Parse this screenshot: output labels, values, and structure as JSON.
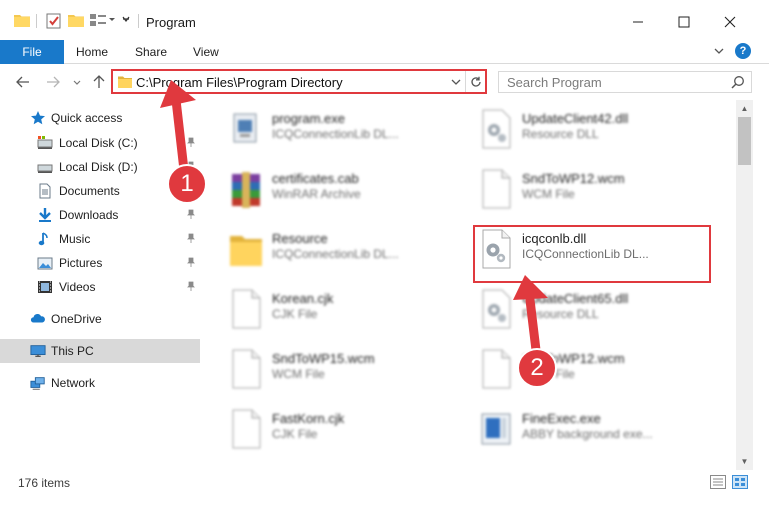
{
  "window": {
    "title": "Program",
    "minimize_icon": "minimize-icon",
    "maximize_icon": "maximize-icon",
    "close_icon": "close-icon"
  },
  "ribbon": {
    "tabs": [
      {
        "label": "File",
        "active": true
      },
      {
        "label": "Home"
      },
      {
        "label": "Share"
      },
      {
        "label": "View"
      }
    ],
    "help": "?"
  },
  "address": {
    "path": "C:\\Program Files\\Program Directory",
    "search_placeholder": "Search Program"
  },
  "sidebar": {
    "items": [
      {
        "label": "Quick access",
        "icon": "star-icon",
        "pinned": false
      },
      {
        "label": "Local Disk (C:)",
        "icon": "drive-icon",
        "pinned": true
      },
      {
        "label": "Local Disk (D:)",
        "icon": "drive-icon",
        "pinned": true
      },
      {
        "label": "Documents",
        "icon": "documents-icon",
        "pinned": true
      },
      {
        "label": "Downloads",
        "icon": "download-icon",
        "pinned": true
      },
      {
        "label": "Music",
        "icon": "music-icon",
        "pinned": true
      },
      {
        "label": "Pictures",
        "icon": "pictures-icon",
        "pinned": true
      },
      {
        "label": "Videos",
        "icon": "videos-icon",
        "pinned": true
      },
      {
        "label": "OneDrive",
        "icon": "cloud-icon",
        "pinned": false
      },
      {
        "label": "This PC",
        "icon": "computer-icon",
        "pinned": false,
        "selected": true
      },
      {
        "label": "Network",
        "icon": "network-icon",
        "pinned": false
      }
    ]
  },
  "files": [
    {
      "name": "program.exe",
      "type": "ICQConnectionLib DL...",
      "icon": "exe-icon"
    },
    {
      "name": "UpdateClient42.dll",
      "type": "Resource DLL",
      "icon": "dll-icon"
    },
    {
      "name": "certificates.cab",
      "type": "WinRAR Archive",
      "icon": "archive-icon"
    },
    {
      "name": "SndToWP12.wcm",
      "type": "WCM File",
      "icon": "document-icon"
    },
    {
      "name": "Resource",
      "type": "ICQConnectionLib DL...",
      "icon": "folder-icon"
    },
    {
      "name": "icqconlb.dll",
      "type": "ICQConnectionLib DL...",
      "icon": "dll-icon",
      "highlighted": true
    },
    {
      "name": "Korean.cjk",
      "type": "CJK File",
      "icon": "document-icon"
    },
    {
      "name": "UpdateClient65.dll",
      "type": "Resource DLL",
      "icon": "dll-icon"
    },
    {
      "name": "SndToWP15.wcm",
      "type": "WCM File",
      "icon": "document-icon"
    },
    {
      "name": "SndToWP12.wcm",
      "type": "WCM File",
      "icon": "document-icon"
    },
    {
      "name": "FastKorn.cjk",
      "type": "CJK File",
      "icon": "document-icon"
    },
    {
      "name": "FineExec.exe",
      "type": "ABBY background exe...",
      "icon": "app-icon"
    }
  ],
  "status": {
    "item_count": "176 items"
  },
  "annotations": {
    "step1": "1",
    "step2": "2",
    "color": "#e0393e"
  },
  "colors": {
    "accent": "#1979ca",
    "selected_bg": "#d9d9d9",
    "folder": "#f4c850"
  }
}
